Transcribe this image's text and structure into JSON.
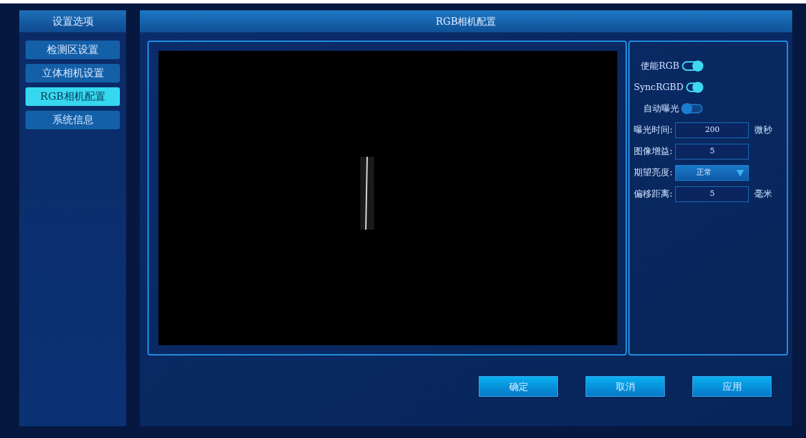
{
  "sidebar": {
    "title": "设置选项",
    "items": [
      {
        "label": "检测区设置",
        "selected": false
      },
      {
        "label": "立体相机设置",
        "selected": false
      },
      {
        "label": "RGB相机配置",
        "selected": true
      },
      {
        "label": "系统信息",
        "selected": false
      }
    ]
  },
  "main": {
    "title": "RGB相机配置",
    "preview": {
      "kind": "picture"
    },
    "settings": [
      {
        "kind": "toggle",
        "label": "使能RGB",
        "on": true
      },
      {
        "kind": "toggle",
        "label": "SyncRGBD",
        "on": true
      },
      {
        "kind": "toggle",
        "label": "自动曝光",
        "on": false
      },
      {
        "kind": "input",
        "label": "曝光时间:",
        "value": "200",
        "unit": "微秒"
      },
      {
        "kind": "input",
        "label": "图像增益:",
        "value": "5"
      },
      {
        "kind": "select",
        "label": "期望亮度:",
        "value": "正常"
      },
      {
        "kind": "input",
        "label": "偏移距离:",
        "value": "5",
        "unit": "毫米"
      }
    ],
    "buttons": [
      "确定",
      "取消",
      "应用"
    ]
  }
}
